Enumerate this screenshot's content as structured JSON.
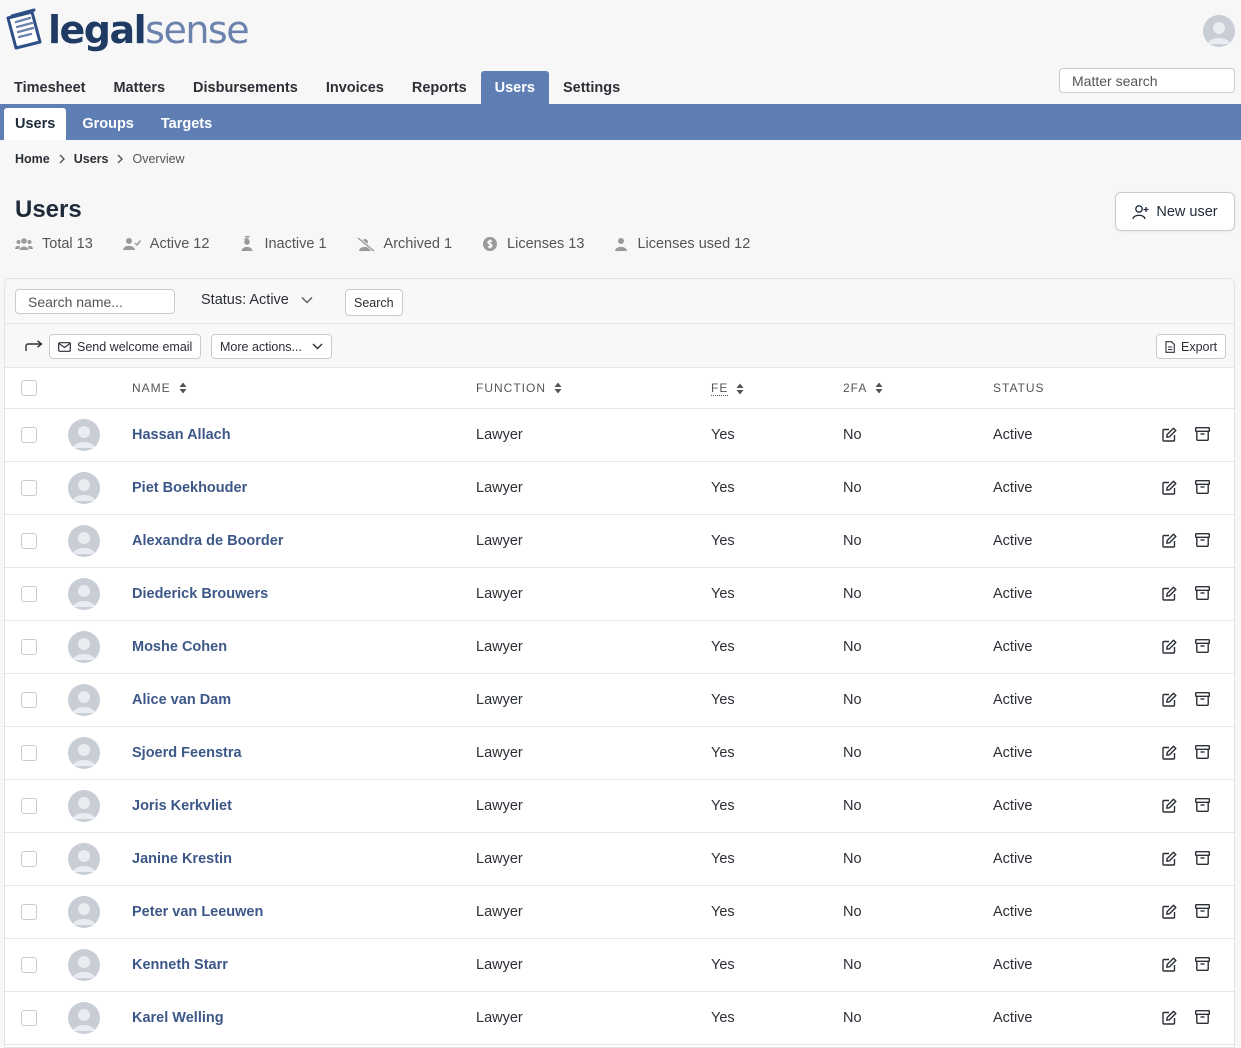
{
  "brand": {
    "part1": "legal",
    "part2": "sense"
  },
  "main_nav": [
    {
      "label": "Timesheet"
    },
    {
      "label": "Matters"
    },
    {
      "label": "Disbursements"
    },
    {
      "label": "Invoices"
    },
    {
      "label": "Reports"
    },
    {
      "label": "Users"
    },
    {
      "label": "Settings"
    }
  ],
  "matter_search": {
    "placeholder": "Matter search"
  },
  "sub_nav": [
    {
      "label": "Users"
    },
    {
      "label": "Groups"
    },
    {
      "label": "Targets"
    }
  ],
  "breadcrumb": [
    "Home",
    "Users",
    "Overview"
  ],
  "page": {
    "title": "Users",
    "new_user_label": "New user"
  },
  "stats": [
    {
      "label": "Total 13",
      "icon": "users-icon"
    },
    {
      "label": "Active 12",
      "icon": "user-check-icon"
    },
    {
      "label": "Inactive 1",
      "icon": "user-sleep-icon"
    },
    {
      "label": "Archived 1",
      "icon": "user-slash-icon"
    },
    {
      "label": "Licenses 13",
      "icon": "license-icon"
    },
    {
      "label": "Licenses used 12",
      "icon": "user-icon"
    }
  ],
  "filters": {
    "search_placeholder": "Search name...",
    "status_label": "Status: Active",
    "search_button": "Search"
  },
  "actions": {
    "send_welcome_email": "Send welcome email",
    "more_actions": "More actions...",
    "export": "Export"
  },
  "table": {
    "columns": {
      "name": "NAME",
      "function": "FUNCTION",
      "fe": "FE",
      "twofa": "2FA",
      "status": "STATUS"
    },
    "rows": [
      {
        "name": "Hassan Allach",
        "function": "Lawyer",
        "fe": "Yes",
        "twofa": "No",
        "status": "Active"
      },
      {
        "name": "Piet Boekhouder",
        "function": "Lawyer",
        "fe": "Yes",
        "twofa": "No",
        "status": "Active"
      },
      {
        "name": "Alexandra de Boorder",
        "function": "Lawyer",
        "fe": "Yes",
        "twofa": "No",
        "status": "Active"
      },
      {
        "name": "Diederick Brouwers",
        "function": "Lawyer",
        "fe": "Yes",
        "twofa": "No",
        "status": "Active"
      },
      {
        "name": "Moshe Cohen",
        "function": "Lawyer",
        "fe": "Yes",
        "twofa": "No",
        "status": "Active"
      },
      {
        "name": "Alice van Dam",
        "function": "Lawyer",
        "fe": "Yes",
        "twofa": "No",
        "status": "Active"
      },
      {
        "name": "Sjoerd Feenstra",
        "function": "Lawyer",
        "fe": "Yes",
        "twofa": "No",
        "status": "Active"
      },
      {
        "name": "Joris Kerkvliet",
        "function": "Lawyer",
        "fe": "Yes",
        "twofa": "No",
        "status": "Active"
      },
      {
        "name": "Janine Krestin",
        "function": "Lawyer",
        "fe": "Yes",
        "twofa": "No",
        "status": "Active"
      },
      {
        "name": "Peter van Leeuwen",
        "function": "Lawyer",
        "fe": "Yes",
        "twofa": "No",
        "status": "Active"
      },
      {
        "name": "Kenneth Starr",
        "function": "Lawyer",
        "fe": "Yes",
        "twofa": "No",
        "status": "Active"
      },
      {
        "name": "Karel Welling",
        "function": "Lawyer",
        "fe": "Yes",
        "twofa": "No",
        "status": "Active"
      }
    ]
  },
  "colors": {
    "accent": "#5f7fb4",
    "brand_dark": "#1f3a63",
    "link": "#3d5888"
  }
}
